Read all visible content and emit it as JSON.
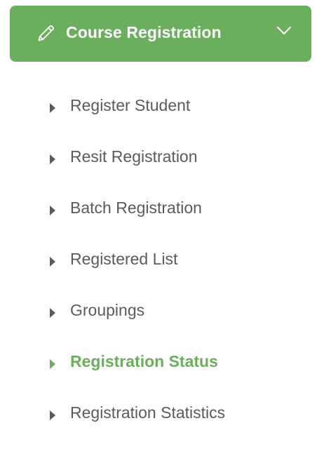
{
  "header": {
    "title": "Course Registration",
    "icon": "pencil-icon",
    "expand_icon": "chevron-down-icon",
    "color": "#6aae5e"
  },
  "submenu": {
    "items": [
      {
        "label": "Register Student",
        "active": false
      },
      {
        "label": "Resit Registration",
        "active": false
      },
      {
        "label": "Batch Registration",
        "active": false
      },
      {
        "label": "Registered List",
        "active": false
      },
      {
        "label": "Groupings",
        "active": false
      },
      {
        "label": "Registration Status",
        "active": true
      },
      {
        "label": "Registration Statistics",
        "active": false
      }
    ],
    "text_color": "#5b5b5b",
    "active_color": "#6aae5e"
  }
}
